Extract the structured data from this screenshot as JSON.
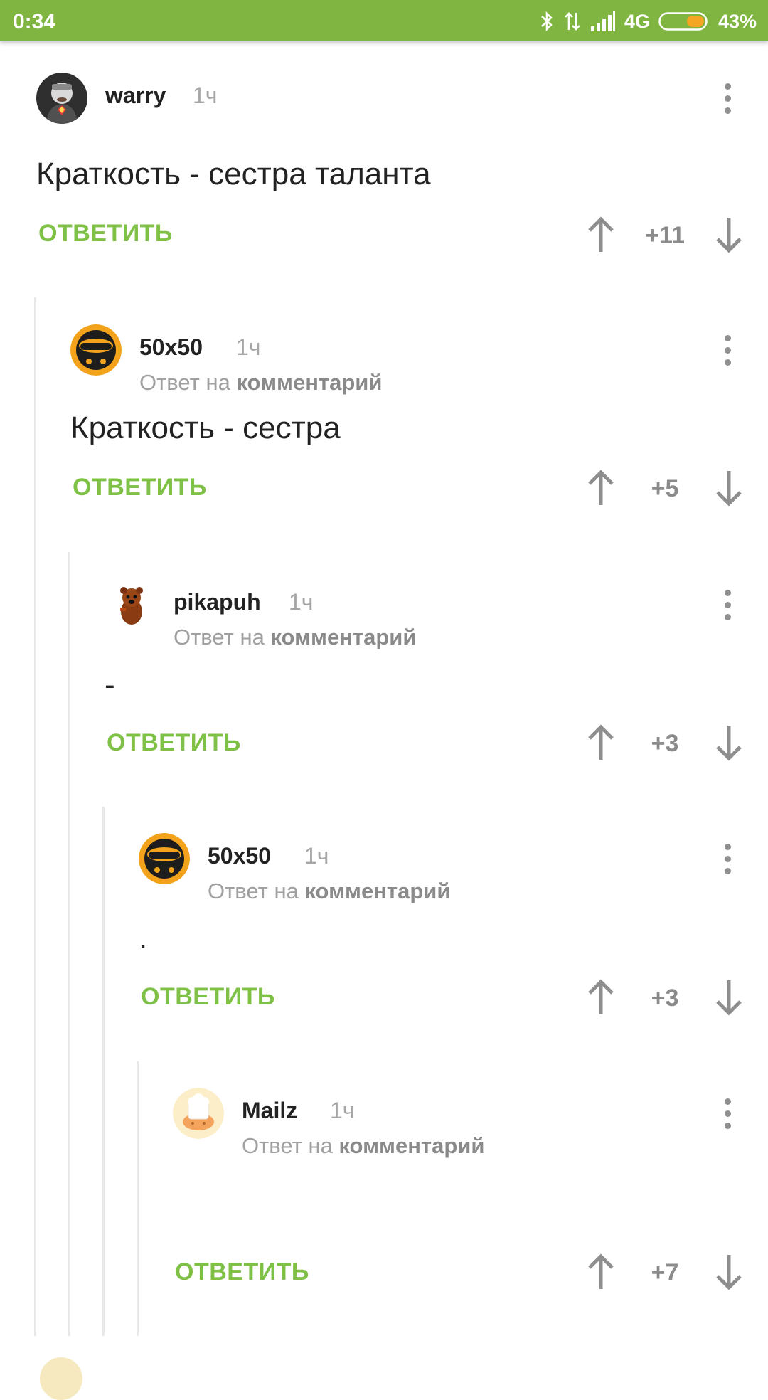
{
  "status_bar": {
    "time": "0:34",
    "network": "4G",
    "battery": "43%",
    "icons": [
      "bluetooth-icon",
      "data-arrows-icon",
      "signal-icon",
      "battery-icon"
    ],
    "colors": {
      "bar": "#7fb540",
      "battery_fill": "#f5a623"
    }
  },
  "ui": {
    "reply_label": "ОТВЕТИТЬ",
    "reply_prefix": "Ответ на",
    "reply_target": "комментарий",
    "accent_color": "#7fc046"
  },
  "comments": [
    {
      "user": "warry",
      "time": "1ч",
      "text": "Краткость - сестра таланта",
      "score": "+11",
      "is_reply": false
    },
    {
      "user": "50x50",
      "time": "1ч",
      "text": "Краткость - сестра",
      "score": "+5",
      "is_reply": true
    },
    {
      "user": "pikapuh",
      "time": "1ч",
      "text": "-",
      "score": "+3",
      "is_reply": true
    },
    {
      "user": "50x50",
      "time": "1ч",
      "text": ".",
      "score": "+3",
      "is_reply": true
    },
    {
      "user": "Mailz",
      "time": "1ч",
      "text": "",
      "score": "+7",
      "is_reply": true
    }
  ]
}
